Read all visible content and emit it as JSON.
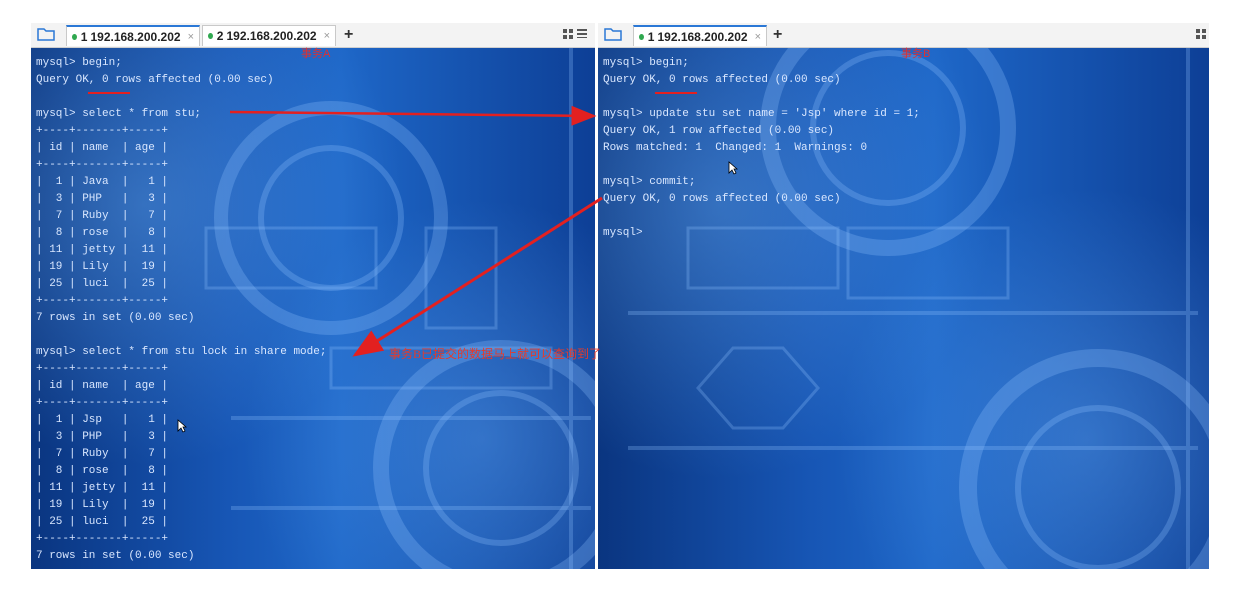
{
  "colors": {
    "annotation": "#e32020",
    "tab_active": "#2b78d6",
    "status_dot": "#2fa84f",
    "terminal_text": "#d9e7ff"
  },
  "left": {
    "tabs": [
      {
        "num": "1",
        "label": "192.168.200.202",
        "close": "×",
        "active": true
      },
      {
        "num": "2",
        "label": "192.168.200.202",
        "close": "×",
        "active": false
      }
    ],
    "plus": "+",
    "annotation_title": "事务A",
    "lines": [
      "mysql> begin;",
      "Query OK, 0 rows affected (0.00 sec)",
      "",
      "mysql> select * from stu;",
      "+----+-------+-----+",
      "| id | name  | age |",
      "+----+-------+-----+",
      "|  1 | Java  |   1 |",
      "|  3 | PHP   |   3 |",
      "|  7 | Ruby  |   7 |",
      "|  8 | rose  |   8 |",
      "| 11 | jetty |  11 |",
      "| 19 | Lily  |  19 |",
      "| 25 | luci  |  25 |",
      "+----+-------+-----+",
      "7 rows in set (0.00 sec)",
      "",
      "mysql> select * from stu lock in share mode;",
      "+----+-------+-----+",
      "| id | name  | age |",
      "+----+-------+-----+",
      "|  1 | Jsp   |   1 |",
      "|  3 | PHP   |   3 |",
      "|  7 | Ruby  |   7 |",
      "|  8 | rose  |   8 |",
      "| 11 | jetty |  11 |",
      "| 19 | Lily  |  19 |",
      "| 25 | luci  |  25 |",
      "+----+-------+-----+",
      "7 rows in set (0.00 sec)"
    ]
  },
  "right": {
    "tabs": [
      {
        "num": "1",
        "label": "192.168.200.202",
        "close": "×",
        "active": true
      }
    ],
    "plus": "+",
    "annotation_title": "事务B",
    "lines": [
      "mysql> begin;",
      "Query OK, 0 rows affected (0.00 sec)",
      "",
      "mysql> update stu set name = 'Jsp' where id = 1;",
      "Query OK, 1 row affected (0.00 sec)",
      "Rows matched: 1  Changed: 1  Warnings: 0",
      "",
      "mysql> commit;",
      "Query OK, 0 rows affected (0.00 sec)",
      "",
      "mysql>"
    ]
  },
  "annotation_note": "事务B已提交的数据马上就可以查询到了"
}
